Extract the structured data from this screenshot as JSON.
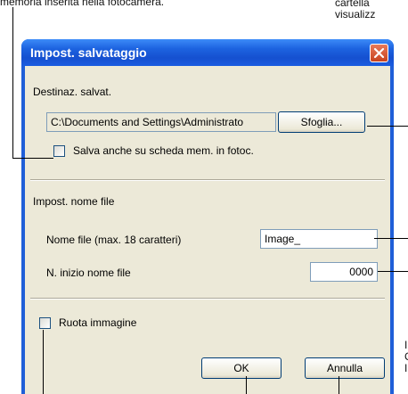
{
  "callouts": {
    "top_left": "memoria inserita nella fotocamera.",
    "top_right_1": "cartella",
    "top_right_2": "visualizz",
    "side_right_1": "I",
    "side_right_2": "C",
    "side_right_3": "I"
  },
  "window": {
    "title": "Impost. salvataggio",
    "close_icon": "close-icon"
  },
  "destination": {
    "label": "Destinaz. salvat.",
    "path": "C:\\Documents and Settings\\Administrato",
    "browse_label": "Sfoglia...",
    "also_save_label": "Salva anche su scheda mem. in fotoc.",
    "also_save_checked": false
  },
  "filename": {
    "section_label": "Impost. nome file",
    "name_label": "Nome file (max. 18 caratteri)",
    "name_value": "Image_",
    "start_label": "N. inizio nome file",
    "start_value": "0000"
  },
  "rotate": {
    "label": "Ruota immagine",
    "checked": false
  },
  "buttons": {
    "ok_label": "OK",
    "cancel_label": "Annulla"
  }
}
